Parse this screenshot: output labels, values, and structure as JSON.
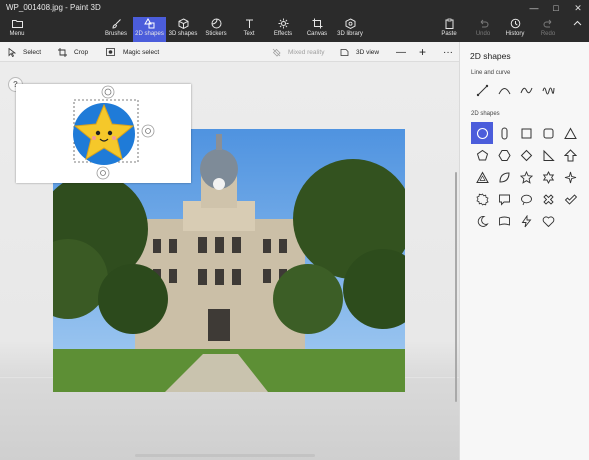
{
  "window": {
    "title": "WP_001408.jpg - Paint 3D"
  },
  "ribbon": {
    "menu_label": "Menu",
    "tabs": [
      {
        "label": "Brushes"
      },
      {
        "label": "2D shapes"
      },
      {
        "label": "3D shapes"
      },
      {
        "label": "Stickers"
      },
      {
        "label": "Text"
      },
      {
        "label": "Effects"
      },
      {
        "label": "Canvas"
      },
      {
        "label": "3D library"
      }
    ],
    "paste_label": "Paste",
    "undo_label": "Undo",
    "history_label": "History",
    "redo_label": "Redo"
  },
  "toolbar": {
    "select_label": "Select",
    "crop_label": "Crop",
    "magic_select_label": "Magic select",
    "mixed_reality_label": "Mixed reality",
    "view_3d_label": "3D view"
  },
  "canvas": {
    "help_label": "?"
  },
  "side_panel": {
    "title": "2D shapes",
    "line_section_label": "Line and curve",
    "shapes_section_label": "2D shapes",
    "line_tools": [
      "line",
      "curve",
      "3-point curve",
      "4-point curve"
    ],
    "shape_tools": [
      "circle",
      "rounded pill",
      "square",
      "rounded square",
      "triangle",
      "pentagon",
      "hexagon",
      "diamond",
      "right triangle",
      "up arrow",
      "outlined triangle",
      "curved shape",
      "star (4-point)",
      "star (6-point)",
      "star (8-point)",
      "gear",
      "speech bubble",
      "thought bubble",
      "cross",
      "check mark",
      "crescent",
      "banner",
      "lightning",
      "heart"
    ]
  },
  "colors": {
    "accent": "#4b5ddb",
    "ribbon_bg": "#2b2b2b",
    "sticker_blue": "#1f7bd8",
    "star_yellow": "#f5c82a"
  }
}
